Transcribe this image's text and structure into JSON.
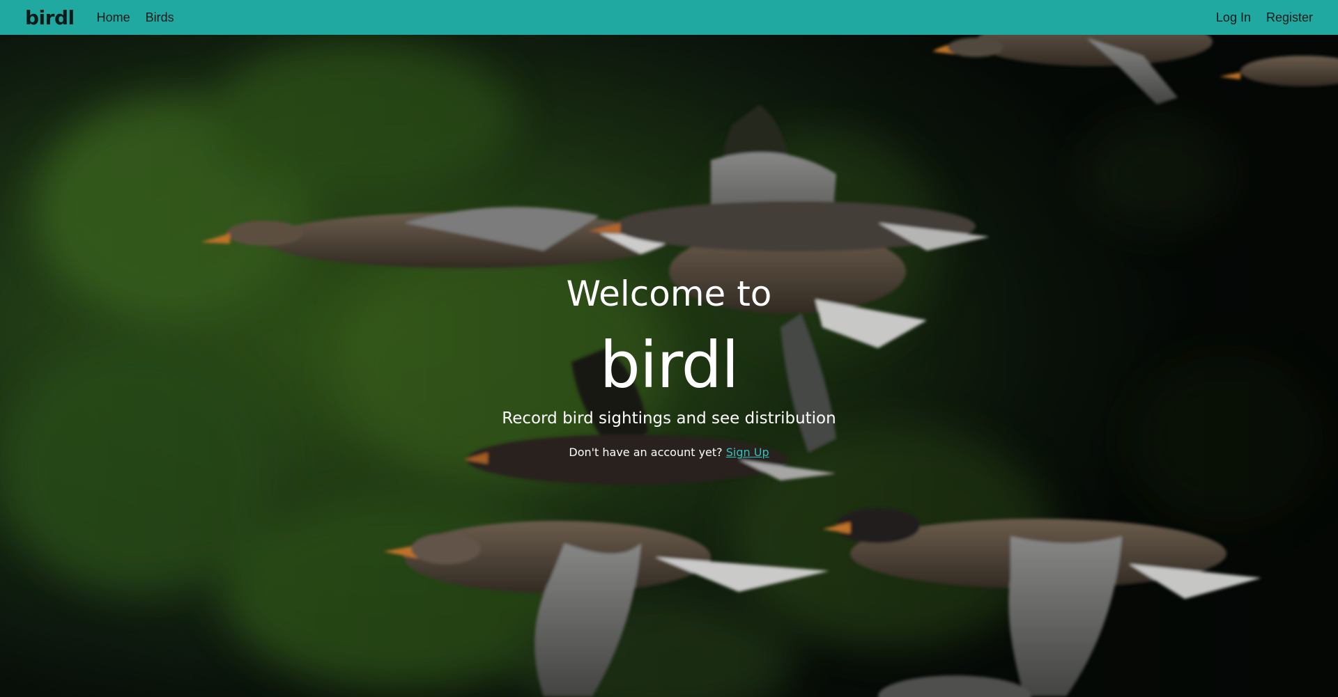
{
  "nav": {
    "brand": "birdl",
    "links": [
      {
        "label": "Home"
      },
      {
        "label": "Birds"
      }
    ],
    "auth": [
      {
        "label": "Log In"
      },
      {
        "label": "Register"
      }
    ]
  },
  "hero": {
    "welcome": "Welcome to",
    "title": "birdl",
    "tagline": "Record bird sightings and see distribution",
    "signup_prompt": "Don't have an account yet?",
    "signup_link": "Sign Up",
    "background_image": "geese-in-flight-photo"
  },
  "colors": {
    "navbar": "#1fa9a1",
    "link_accent": "#2fc4bb",
    "hero_text": "#ffffff"
  }
}
